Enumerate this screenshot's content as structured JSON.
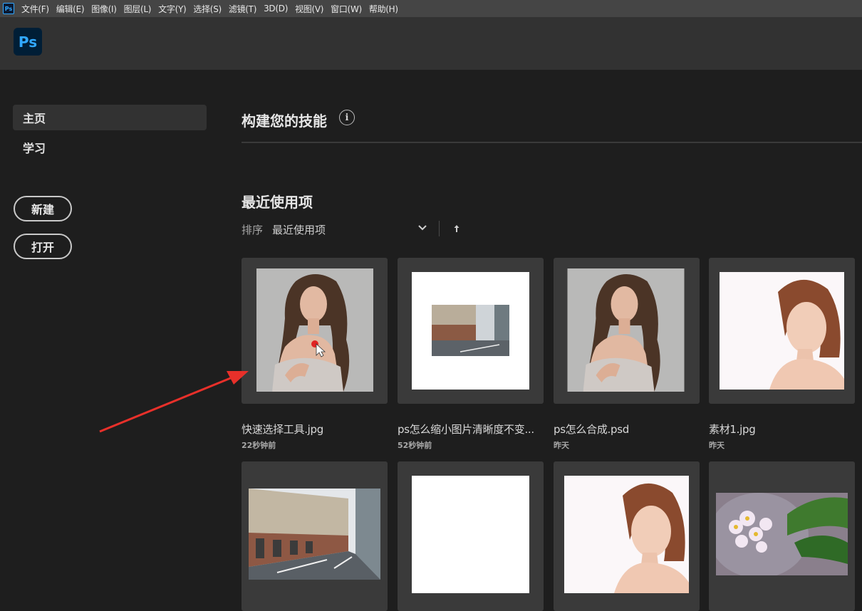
{
  "menubar": {
    "app_icon": "Ps",
    "items": [
      "文件(F)",
      "编辑(E)",
      "图像(I)",
      "图层(L)",
      "文字(Y)",
      "选择(S)",
      "滤镜(T)",
      "3D(D)",
      "视图(V)",
      "窗口(W)",
      "帮助(H)"
    ]
  },
  "header": {
    "logo": "Ps"
  },
  "sidebar": {
    "nav": [
      {
        "label": "主页",
        "active": true
      },
      {
        "label": "学习",
        "active": false
      }
    ],
    "buttons": {
      "new": "新建",
      "open": "打开"
    }
  },
  "main": {
    "skills_title": "构建您的技能",
    "info_glyph": "i",
    "recent_title": "最近使用项",
    "sort": {
      "label": "排序",
      "value": "最近使用项"
    },
    "files": [
      {
        "name": "快速选择工具.jpg",
        "time": "22秒钟前",
        "thumb": "portrait-curly"
      },
      {
        "name": "ps怎么缩小图片清晰度不变...",
        "time": "52秒钟前",
        "thumb": "street-small"
      },
      {
        "name": "ps怎么合成.psd",
        "time": "昨天",
        "thumb": "portrait-curly"
      },
      {
        "name": "素材1.jpg",
        "time": "昨天",
        "thumb": "portrait-red"
      },
      {
        "name": "",
        "time": "",
        "thumb": "street-large"
      },
      {
        "name": "",
        "time": "",
        "thumb": "blank"
      },
      {
        "name": "",
        "time": "",
        "thumb": "portrait-red"
      },
      {
        "name": "",
        "time": "",
        "thumb": "flowers"
      }
    ]
  },
  "colors": {
    "menubar": "#454545",
    "header": "#323232",
    "background": "#1e1e1e",
    "card": "#3a3a3a",
    "ps_blue": "#31a8ff",
    "annotation_arrow": "#e8302a"
  }
}
